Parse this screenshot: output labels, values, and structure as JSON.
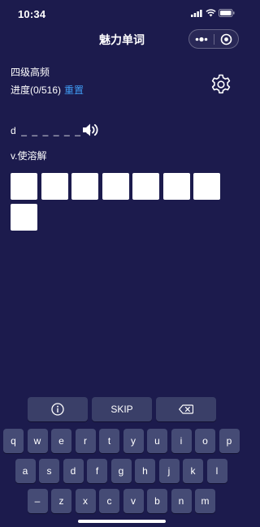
{
  "status_bar": {
    "time": "10:34"
  },
  "nav": {
    "title": "魅力单词"
  },
  "word": {
    "level": "四级高频",
    "progress": "进度(0/516)",
    "reset_label": "重置",
    "hint": "d _ _ _ _ _ _ e",
    "meaning": "v.使溶解"
  },
  "keyboard": {
    "skip_label": "SKIP",
    "row1": [
      "q",
      "w",
      "e",
      "r",
      "t",
      "y",
      "u",
      "i",
      "o",
      "p"
    ],
    "row2": [
      "a",
      "s",
      "d",
      "f",
      "g",
      "h",
      "j",
      "k",
      "l"
    ],
    "row3": [
      "–",
      "z",
      "x",
      "c",
      "v",
      "b",
      "n",
      "m"
    ]
  },
  "colors": {
    "background": "#1c1b4d",
    "accent_link": "#3f9df5",
    "key": "#454b75"
  },
  "icons": [
    "signal-icon",
    "wifi-icon",
    "battery-icon",
    "more-icon",
    "target-icon",
    "gear-icon",
    "speaker-icon",
    "info-icon",
    "backspace-icon"
  ]
}
